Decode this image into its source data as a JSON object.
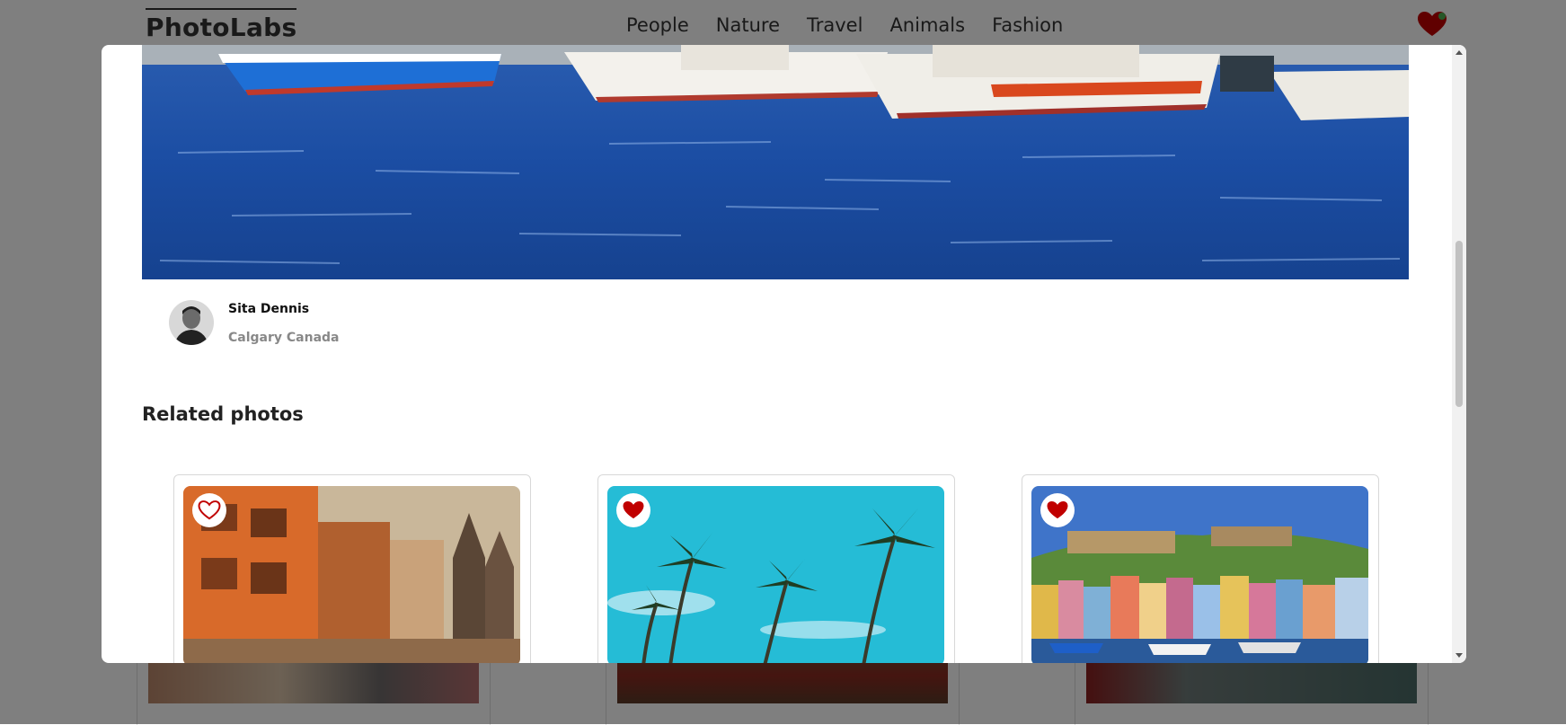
{
  "app": {
    "logo": "PhotoLabs"
  },
  "nav": {
    "topics": [
      "People",
      "Nature",
      "Travel",
      "Animals",
      "Fashion"
    ],
    "fav_icon": "heart-icon",
    "has_favorites": true
  },
  "modal": {
    "photographer": {
      "name": "Sita Dennis",
      "location": "Calgary Canada"
    },
    "related_title": "Related photos",
    "related_photos": [
      {
        "image": "city-buildings-photo",
        "favorited": false
      },
      {
        "image": "palm-trees-photo",
        "favorited": true
      },
      {
        "image": "harbor-town-photo",
        "favorited": true
      }
    ]
  },
  "colors": {
    "heart_red": "#C00000",
    "accent_green": "#4CAF50",
    "overlay": "rgba(0,0,0,0.5)"
  }
}
